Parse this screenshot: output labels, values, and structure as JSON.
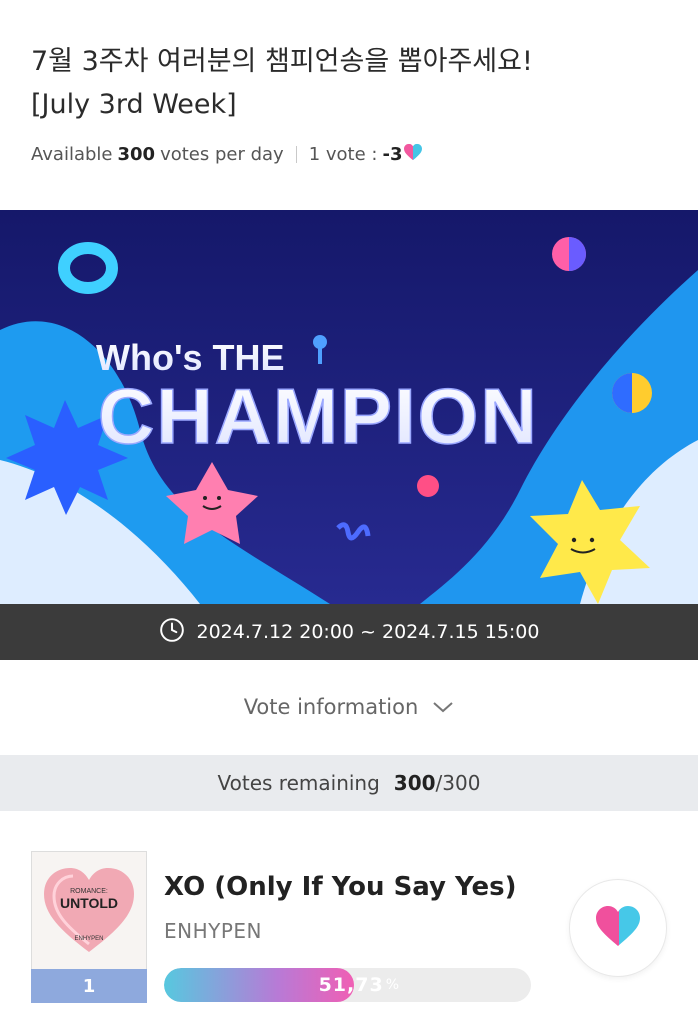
{
  "header": {
    "title_line1": "7월 3주차 여러분의 챔피언송을 뽑아주세요!",
    "title_line2": "[July 3rd Week]",
    "available_prefix": "Available",
    "available_count": "300",
    "available_suffix": "votes per day",
    "vote_label": "1 vote :",
    "vote_cost": "-3"
  },
  "banner": {
    "line1": "Who's THE",
    "line2": "CHAMPION"
  },
  "period": {
    "text": "2024.7.12 20:00 ~ 2024.7.15 15:00"
  },
  "vote_info": {
    "label": "Vote information"
  },
  "remaining": {
    "label": "Votes remaining",
    "used": "300",
    "total": "/300"
  },
  "entries": [
    {
      "rank": "1",
      "song": "XO (Only If You Say Yes)",
      "artist": "ENHYPEN",
      "percent_text": "51,73",
      "percent_unit": "%",
      "share": 0.5173,
      "album_text_top": "ROMANCE:",
      "album_text_main": "UNTOLD",
      "album_text_bottom": "ENHYPEN"
    }
  ],
  "colors": {
    "rank_bg": "#8ea9dd",
    "banner_bg": "#1c1f78",
    "date_bar_bg": "#3b3b3b",
    "remaining_bg": "#e9ebee"
  },
  "icons": {
    "heart": "heart-icon",
    "clock": "clock-icon",
    "chevron": "chevron-down-icon"
  }
}
